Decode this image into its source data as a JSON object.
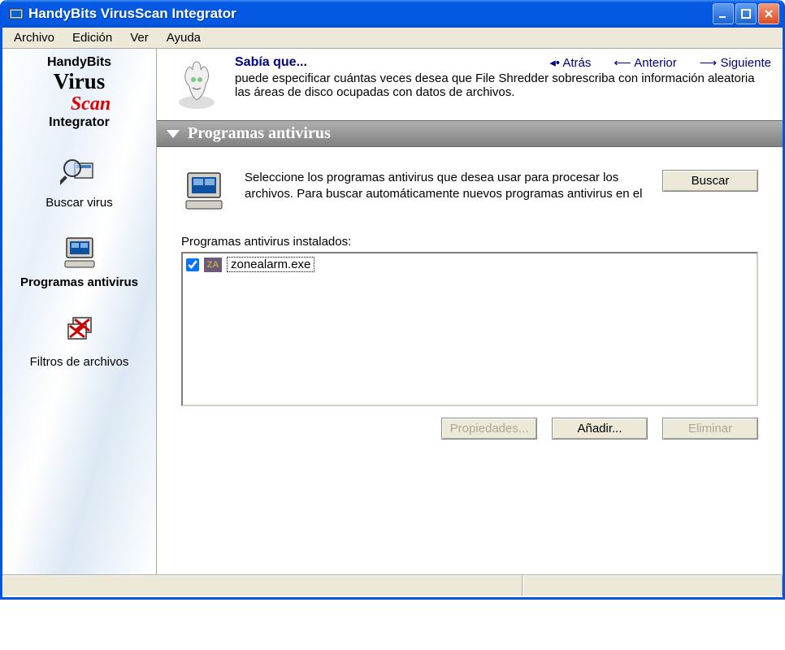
{
  "window": {
    "title": "HandyBits VirusScan Integrator"
  },
  "menubar": {
    "items": [
      "Archivo",
      "Edición",
      "Ver",
      "Ayuda"
    ]
  },
  "sidebar": {
    "logo": {
      "l1": "HandyBits",
      "l2": "Virus",
      "l3": "Scan",
      "l4": "Integrator"
    },
    "items": [
      {
        "label": "Buscar virus"
      },
      {
        "label": "Programas antivirus"
      },
      {
        "label": "Filtros de archivos"
      }
    ]
  },
  "tip": {
    "title": "Sabía que...",
    "body": "puede especificar cuántas veces desea que File Shredder sobrescriba con información aleatoria las áreas de disco ocupadas con datos de archivos.",
    "nav": {
      "back": "Atrás",
      "prev": "Anterior",
      "next": "Siguiente"
    }
  },
  "section": {
    "header": "Programas antivirus",
    "intro": "Seleccione los programas antivirus que desea usar para procesar los archivos. Para buscar automáticamente nuevos programas antivirus en el",
    "search_btn": "Buscar",
    "list_label": "Programas antivirus instalados:",
    "programs": [
      {
        "icon": "ZA",
        "name": "zonealarm.exe",
        "checked": true
      }
    ],
    "buttons": {
      "properties": "Propiedades...",
      "add": "Añadir...",
      "remove": "Eliminar"
    }
  }
}
